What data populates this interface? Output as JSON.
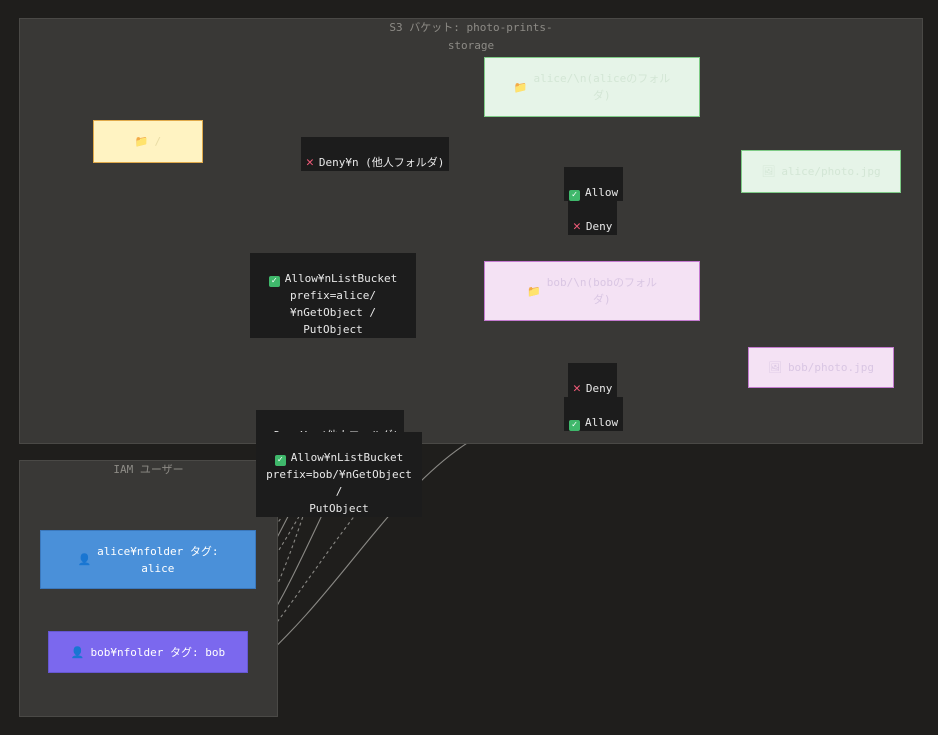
{
  "clusters": {
    "s3": {
      "title": "S3 バケット: photo-prints-\nstorage"
    },
    "iam": {
      "title": "IAM ユーザー"
    }
  },
  "nodes": {
    "root": {
      "icon": "folder-icon",
      "glyph": "📁",
      "label": "/"
    },
    "alice_folder": {
      "icon": "folder-icon",
      "glyph": "📁",
      "label": "alice/\\n(aliceのフォル\nダ)"
    },
    "alice_file": {
      "icon": "file-icon",
      "glyph": "🖼",
      "label": "alice/photo.jpg"
    },
    "bob_folder": {
      "icon": "folder-icon",
      "glyph": "📁",
      "label": "bob/\\n(bobのフォル\nダ)"
    },
    "bob_file": {
      "icon": "file-icon",
      "glyph": "🖼",
      "label": "bob/photo.jpg"
    },
    "user_alice": {
      "icon": "user-icon",
      "glyph": "👤",
      "label": "alice¥nfolder タグ:\nalice"
    },
    "user_bob": {
      "icon": "user-icon",
      "glyph": "👤",
      "label": "bob¥nfolder タグ: bob"
    }
  },
  "edge_labels": {
    "deny_alice_other": {
      "status": "deny",
      "text": "Deny¥n (他人フォルダ)"
    },
    "allow_alice_file": {
      "status": "allow",
      "text": "Allow"
    },
    "deny_alice_file": {
      "status": "deny",
      "text": "Deny"
    },
    "allow_alice_list": {
      "status": "allow",
      "text": "Allow¥nListBucket\nprefix=alice/¥nGetObject /\nPutObject"
    },
    "deny_bob_file": {
      "status": "deny",
      "text": "Deny"
    },
    "allow_bob_file": {
      "status": "allow",
      "text": "Allow"
    },
    "deny_bob_other": {
      "status": "deny",
      "text": "Deny¥n (他人フォルダ)"
    },
    "allow_bob_list": {
      "status": "allow",
      "text": "Allow¥nListBucket\nprefix=bob/¥nGetObject /\nPutObject"
    }
  },
  "colors": {
    "allow": "#3fb86b",
    "deny": "#f05a78",
    "edge": "#8a8985"
  }
}
